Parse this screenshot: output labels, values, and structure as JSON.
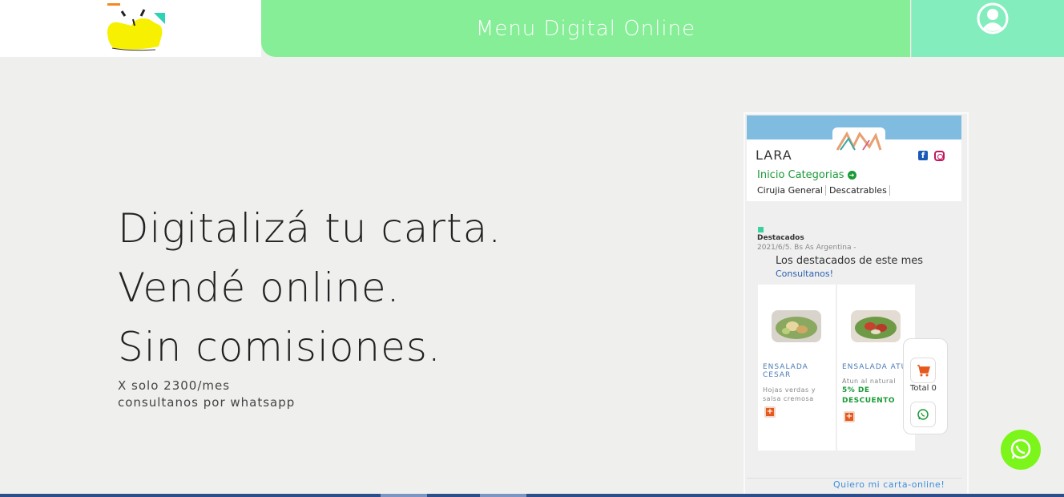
{
  "header": {
    "title": "Menu Digital Online",
    "logo_icon": "brand-logo",
    "user_icon": "user-account-icon",
    "colors": {
      "title_bar": "#85ee96",
      "user_bar": "#83edbe"
    }
  },
  "hero": {
    "lines": [
      "Digitalizá tu carta.",
      "Vendé online.",
      "Sin comisiones."
    ],
    "price": "X solo 2300/mes",
    "contact": "consultanos por whatsapp"
  },
  "preview": {
    "store_name": "LARA",
    "nav_label": "Inicio Categorias",
    "categories": [
      "Cirujia General",
      "Descatrables"
    ],
    "featured_label": "Destacados",
    "date_location": "2021/6/5. Bs As Argentina -",
    "featured_title": "Los destacados de este mes",
    "featured_link": "Consultanos!",
    "products": [
      {
        "name": "ENSALADA CESAR",
        "description": "Hojas verdas y salsa cremosa",
        "discount": ""
      },
      {
        "name": "ENSALADA ATUN",
        "description": "Atun al natural",
        "discount": "5% DE DESCUENTO"
      }
    ],
    "cart_total": "Total 0",
    "footer_link": "Quiero mi carta-online!"
  },
  "whatsapp_icon": "whatsapp-icon",
  "accent_colors": {
    "green": "#1a9a36",
    "whatsapp_float": "#7cf51b",
    "link_blue": "#3d8edb"
  }
}
